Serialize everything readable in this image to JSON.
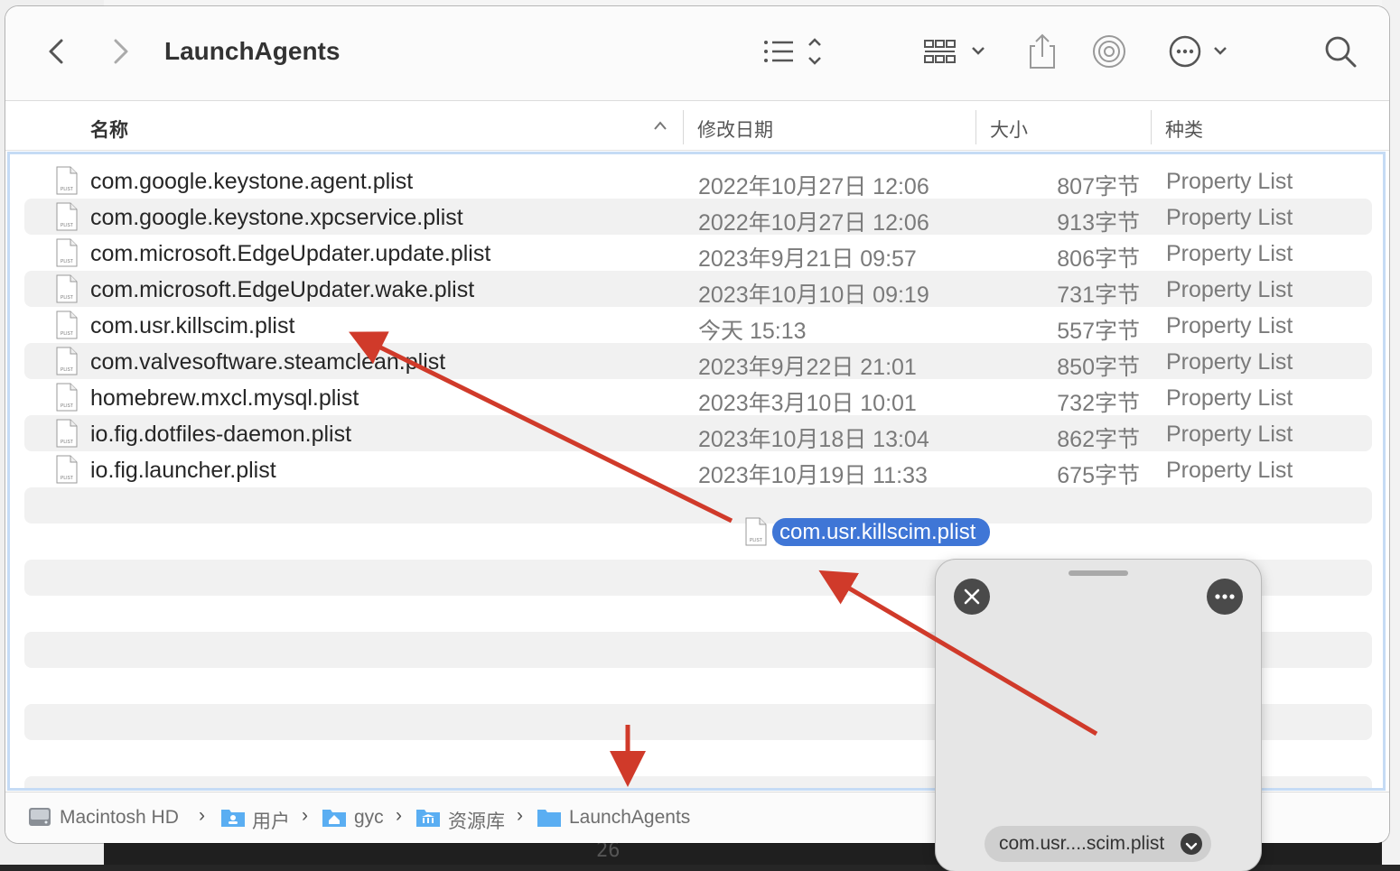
{
  "window": {
    "title": "LaunchAgents"
  },
  "columns": {
    "name": "名称",
    "date": "修改日期",
    "size": "大小",
    "kind": "种类"
  },
  "files": [
    {
      "name": "com.google.keystone.agent.plist",
      "date": "2022年10月27日 12:06",
      "size": "807字节",
      "kind": "Property List",
      "icon_label": "PLIST"
    },
    {
      "name": "com.google.keystone.xpcservice.plist",
      "date": "2022年10月27日 12:06",
      "size": "913字节",
      "kind": "Property List",
      "icon_label": "PLIST"
    },
    {
      "name": "com.microsoft.EdgeUpdater.update.plist",
      "date": "2023年9月21日 09:57",
      "size": "806字节",
      "kind": "Property List",
      "icon_label": "PLIST"
    },
    {
      "name": "com.microsoft.EdgeUpdater.wake.plist",
      "date": "2023年10月10日 09:19",
      "size": "731字节",
      "kind": "Property List",
      "icon_label": "PLIST"
    },
    {
      "name": "com.usr.killscim.plist",
      "date": "今天 15:13",
      "size": "557字节",
      "kind": "Property List",
      "icon_label": "PLIST"
    },
    {
      "name": "com.valvesoftware.steamclean.plist",
      "date": "2023年9月22日 21:01",
      "size": "850字节",
      "kind": "Property List",
      "icon_label": "PLIST"
    },
    {
      "name": "homebrew.mxcl.mysql.plist",
      "date": "2023年3月10日 10:01",
      "size": "732字节",
      "kind": "Property List",
      "icon_label": "PLIST"
    },
    {
      "name": "io.fig.dotfiles-daemon.plist",
      "date": "2023年10月18日 13:04",
      "size": "862字节",
      "kind": "Property List",
      "icon_label": "PLIST"
    },
    {
      "name": "io.fig.launcher.plist",
      "date": "2023年10月19日 11:33",
      "size": "675字节",
      "kind": "Property List",
      "icon_label": "PLIST"
    }
  ],
  "drag": {
    "label": "com.usr.killscim.plist",
    "icon_label": "PLIST"
  },
  "preview": {
    "filename": "com.usr....scim.plist"
  },
  "pathbar": {
    "items": [
      "Macintosh HD",
      "用户",
      "gyc",
      "资源库",
      "LaunchAgents"
    ]
  },
  "background": {
    "line_number": "26"
  },
  "colors": {
    "accent": "#3f76d6",
    "annotation_arrow": "#d03a2a",
    "folder": "#5aaef2"
  }
}
